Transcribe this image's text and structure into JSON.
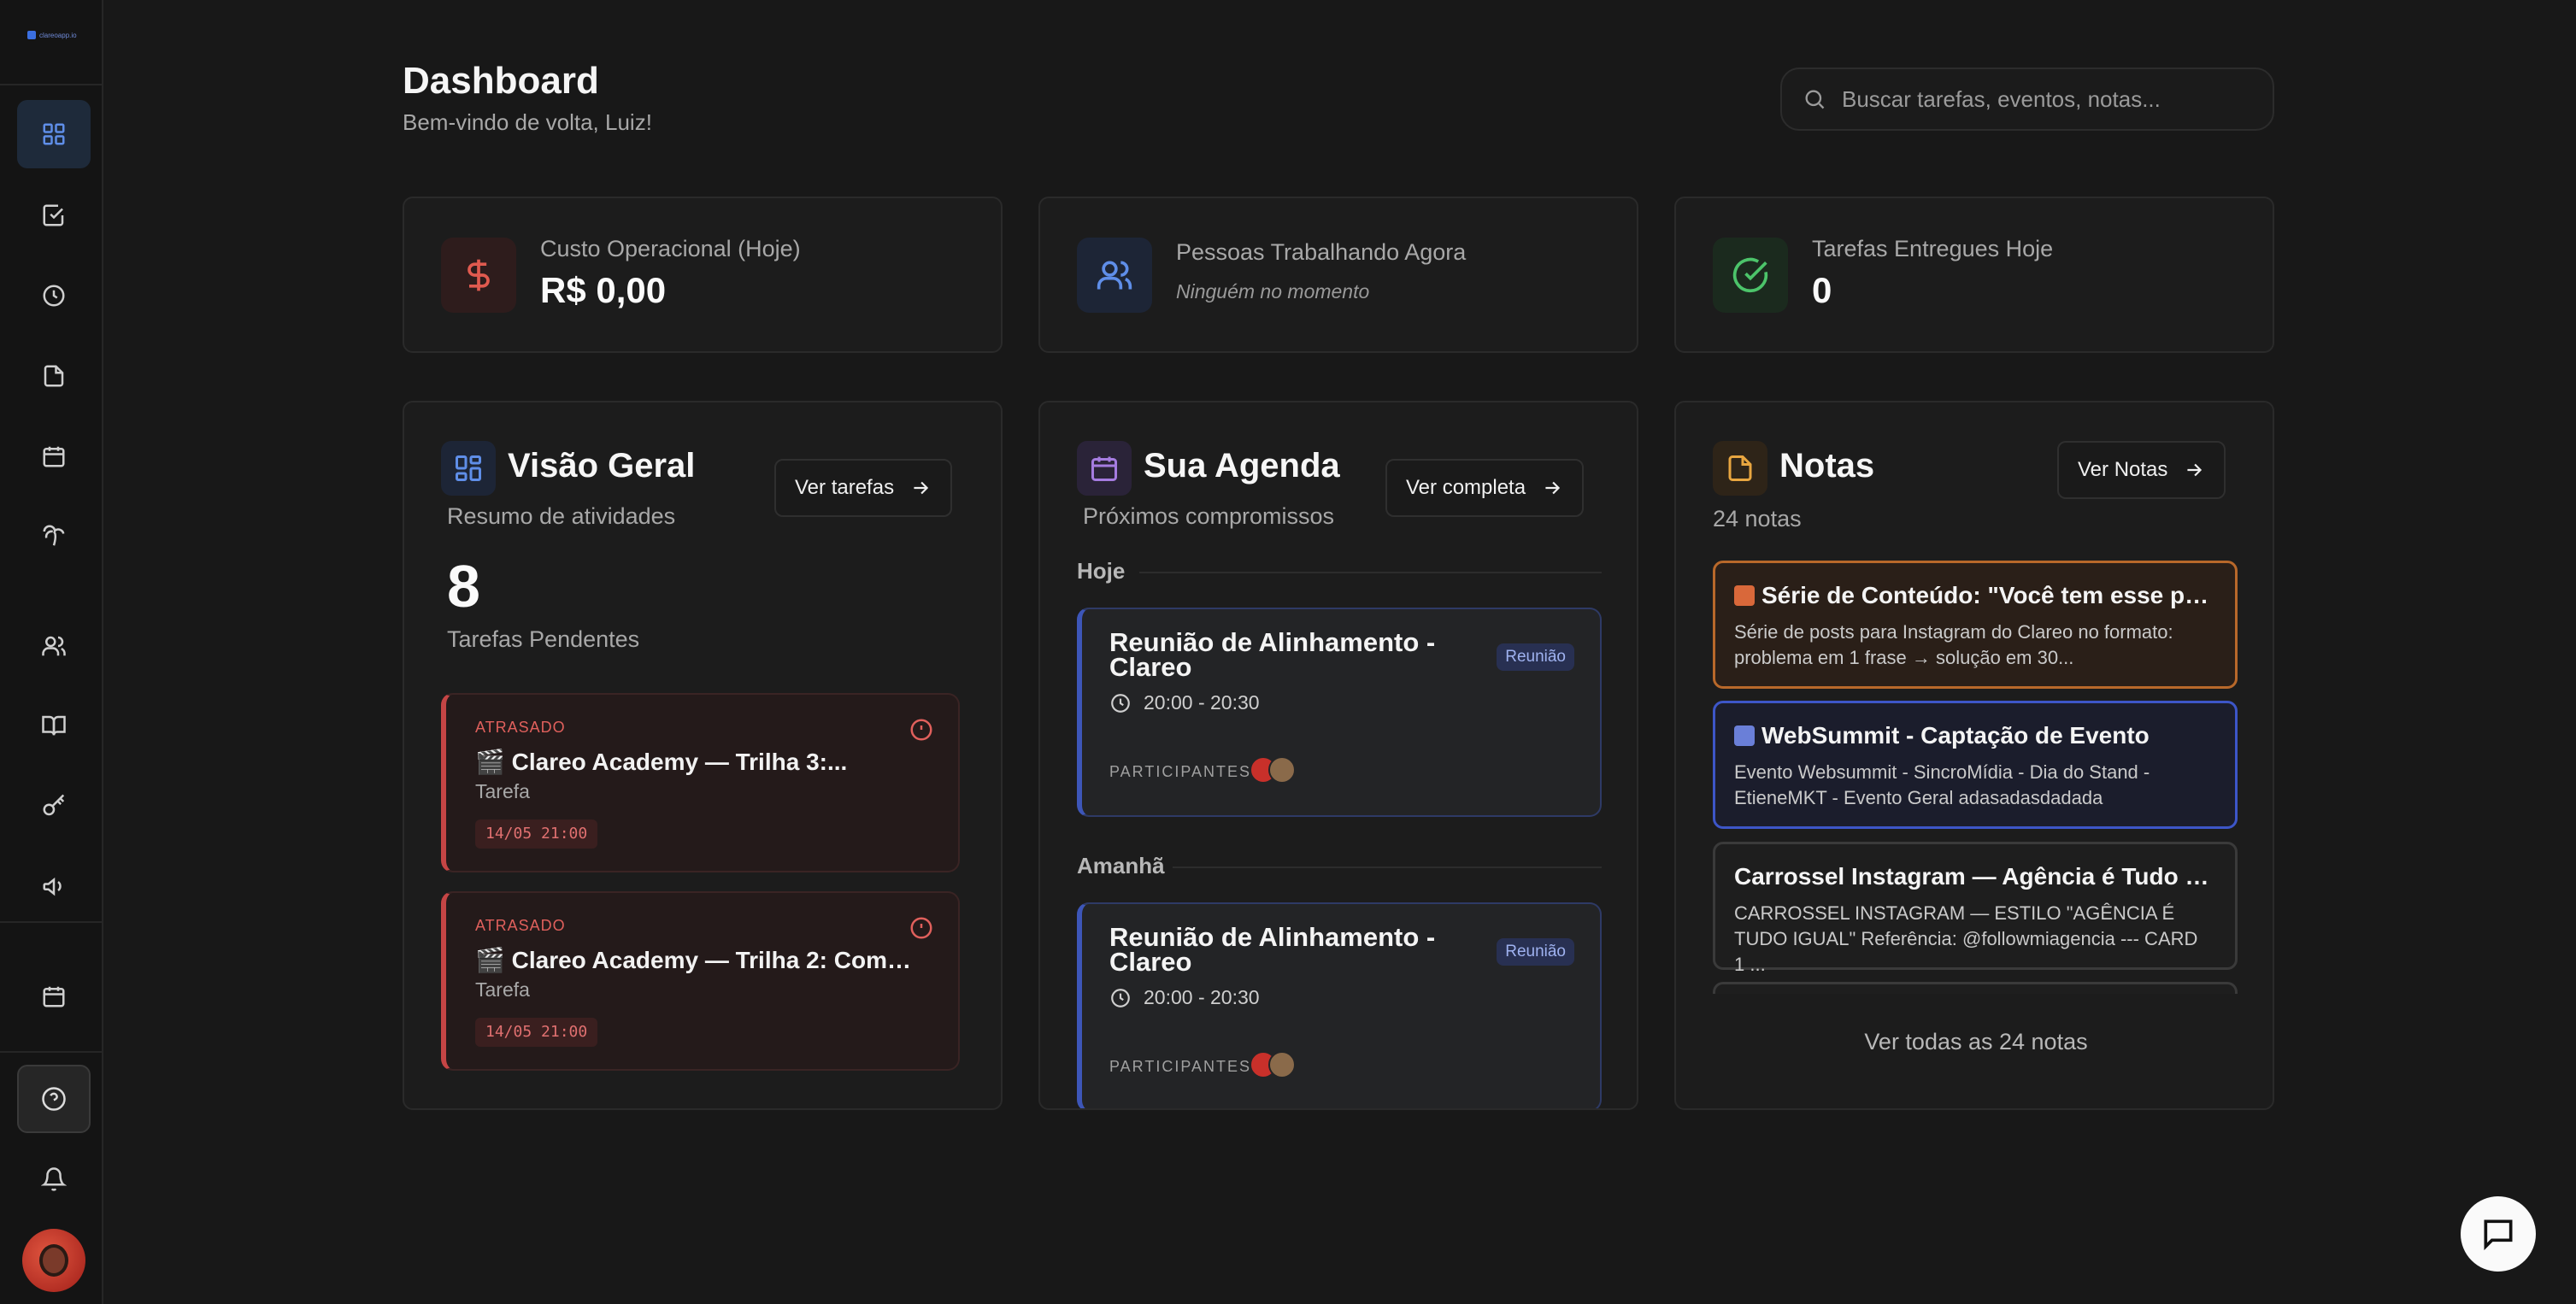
{
  "brand": {
    "logo_text": "clareoapp.io"
  },
  "sidebar": {
    "items": [
      {
        "name": "dashboard",
        "icon": "grid-icon",
        "active": true
      },
      {
        "name": "tasks",
        "icon": "checkbox-icon"
      },
      {
        "name": "time",
        "icon": "clock-icon"
      },
      {
        "name": "notes",
        "icon": "file-icon"
      },
      {
        "name": "calendar",
        "icon": "calendar-icon"
      },
      {
        "name": "finance",
        "icon": "palm-icon"
      },
      {
        "name": "people",
        "icon": "users-icon"
      },
      {
        "name": "library",
        "icon": "book-icon"
      },
      {
        "name": "keys",
        "icon": "key-icon"
      },
      {
        "name": "marketing",
        "icon": "megaphone-icon"
      },
      {
        "name": "schedule",
        "icon": "calendar-icon"
      },
      {
        "name": "help",
        "icon": "help-icon"
      },
      {
        "name": "notifications",
        "icon": "bell-icon"
      }
    ]
  },
  "header": {
    "title": "Dashboard",
    "subtitle": "Bem-vindo de volta, Luiz!",
    "search_placeholder": "Buscar tarefas, eventos, notas..."
  },
  "stats": [
    {
      "label": "Custo Operacional (Hoje)",
      "value": "R$ 0,00",
      "icon": "dollar-icon",
      "color": "#e05a4f"
    },
    {
      "label": "Pessoas Trabalhando Agora",
      "value": "Ninguém no momento",
      "icon": "users-icon",
      "color": "#5f8ee8"
    },
    {
      "label": "Tarefas Entregues Hoje",
      "value": "0",
      "icon": "check-circle-icon",
      "color": "#4cc46a"
    }
  ],
  "overview": {
    "title": "Visão Geral",
    "subtitle": "Resumo de atividades",
    "button": "Ver tarefas",
    "count": "8",
    "count_label": "Tarefas Pendentes",
    "tasks": [
      {
        "status": "ATRASADO",
        "title": "🎬 Clareo Academy — Trilha 3:...",
        "type": "Tarefa",
        "date": "14/05 21:00"
      },
      {
        "status": "ATRASADO",
        "title": "🎬 Clareo Academy — Trilha 2: Como...",
        "type": "Tarefa",
        "date": "14/05 21:00"
      }
    ]
  },
  "agenda": {
    "title": "Sua Agenda",
    "subtitle": "Próximos compromissos",
    "button": "Ver completa",
    "days": [
      {
        "label": "Hoje",
        "event": {
          "title": "Reunião de Alinhamento - Clareo",
          "badge": "Reunião",
          "time": "20:00 - 20:30",
          "participants_label": "PARTICIPANTES"
        }
      },
      {
        "label": "Amanhã",
        "event": {
          "title": "Reunião de Alinhamento - Clareo",
          "badge": "Reunião",
          "time": "20:00 - 20:30",
          "participants_label": "PARTICIPANTES"
        }
      }
    ]
  },
  "notes": {
    "title": "Notas",
    "count": "24 notas",
    "button": "Ver Notas",
    "items": [
      {
        "title": "Série de Conteúdo: \"Você tem esse pro...",
        "body": "Série de posts para Instagram do Clareo no formato: problema em 1 frase → solução em 30...",
        "border": "#b8682a",
        "bg": "#2a1f18",
        "icon_color": "#d9683a"
      },
      {
        "title": "WebSummit - Captação de Evento",
        "body": "Evento Websummit - SincroMídia - Dia do Stand - EtieneMKT - Evento Geral adasadasdadada",
        "border": "#3d56c8",
        "bg": "#1b1d2c",
        "icon_color": "#6a7fd8"
      },
      {
        "title": "Carrossel Instagram — Agência é Tudo Ig...",
        "body": "CARROSSEL INSTAGRAM — ESTILO \"AGÊNCIA É TUDO IGUAL\" Referência: @followmiagencia --- CARD 1 ...",
        "border": "#3a3a3a",
        "bg": "#1e1e1e",
        "icon_color": ""
      }
    ],
    "view_all": "Ver todas as 24 notas"
  }
}
